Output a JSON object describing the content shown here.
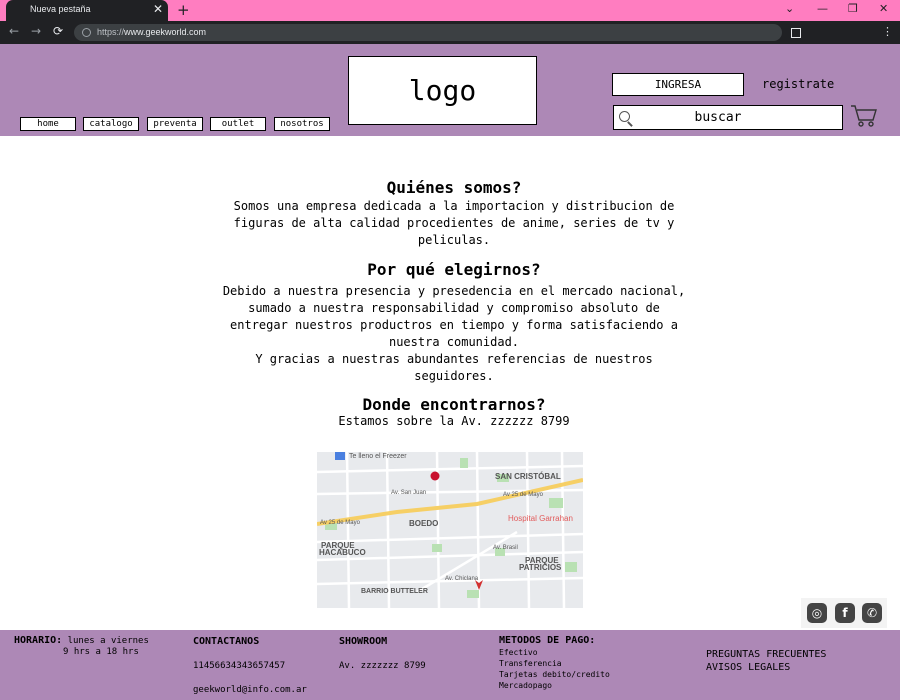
{
  "browser": {
    "tab_title": "Nueva pestaña",
    "tab_close": "✕",
    "new_tab": "+",
    "url_prefix": "https://",
    "url_host": "www.geekworld.com",
    "controls": {
      "chevron": "⌄",
      "minimize": "—",
      "restore": "❐",
      "close": "✕",
      "menu": "⋮"
    },
    "nav": {
      "back": "←",
      "forward": "→",
      "reload": "⟳"
    }
  },
  "header": {
    "nav": [
      "home",
      "catalogo",
      "preventa",
      "outlet",
      "nosotros"
    ],
    "logo": "logo",
    "login_label": "INGRESA",
    "register_label": "registrate",
    "search_placeholder": "buscar",
    "cart_icon": "cart-icon"
  },
  "content": {
    "about_title": "Quiénes somos?",
    "about_lines": [
      "Somos una empresa dedicada a la importacion y distribucion de",
      "figuras de alta calidad procedientes de anime, series de tv y",
      "peliculas."
    ],
    "why_title": "Por qué elegirnos?",
    "why_lines": [
      "Debido a nuestra presencia y presedencia en el mercado nacional,",
      "sumado a nuestra responsabilidad y compromiso absoluto de",
      "entregar nuestros productros en tiempo y forma satisfaciendo a",
      "nuestra comunidad.",
      "Y gracias a nuestras abundantes referencias de nuestros",
      "seguidores."
    ],
    "where_title": "Donde encontrarnos?",
    "where_text": "Estamos sobre la Av. zzzzzz 8799"
  },
  "map": {
    "labels": {
      "top_left": "Te lleno el Freezer",
      "san_cristobal": "SAN CRISTÓBAL",
      "av_san_juan": "Av. San Juan",
      "av_25_a": "Av 25 de Mayo",
      "av_25_b": "Av 25 de Mayo",
      "boedo": "BOEDO",
      "hospital": "Hospital Garrahan",
      "parque_hacabuco_1": "PARQUE",
      "parque_hacabuco_2": "HACABUCO",
      "av_brasil": "Av. Brasil",
      "parque_patricios_1": "PARQUE",
      "parque_patricios_2": "PATRICIOS",
      "av_chiclana": "Av. Chiclana",
      "barrio_butteler": "BARRIO BUTTELER"
    },
    "colors": {
      "base": "#e8eaed",
      "avenue": "#f6cf65",
      "hospital": "#e25b5b",
      "park": "#b9e1b3"
    }
  },
  "social": [
    "instagram-icon",
    "facebook-icon",
    "whatsapp-icon"
  ],
  "footer": {
    "horario_label": "HORARIO:",
    "horario_days": "lunes a viernes",
    "horario_hours": "9 hrs a 18 hrs",
    "contact_title": "CONTACTANOS",
    "contact_phone": "11456634343657457",
    "contact_email": "geekworld@info.com.ar",
    "showroom_title": "SHOWROOM",
    "showroom_address": "Av. zzzzzzz 8799",
    "payment_title": "METODOS DE PAGO:",
    "payment_methods": [
      "Efectivo",
      "Transferencia",
      "Tarjetas debito/credito",
      "Mercadopago"
    ],
    "faq": "PREGUNTAS FRECUENTES",
    "legal": "AVISOS LEGALES"
  },
  "colors": {
    "header_bg": "#ad88b6",
    "tabbar_bg": "#ff7dc0",
    "chrome_dark": "#202124"
  }
}
